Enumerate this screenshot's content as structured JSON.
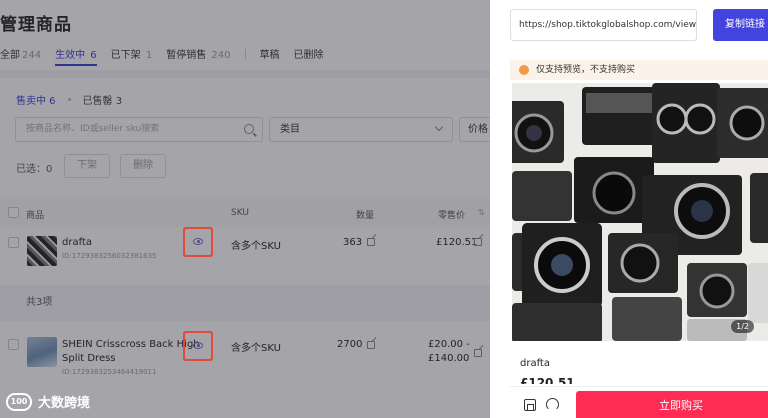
{
  "page": {
    "title": "管理商品",
    "status_tabs": [
      {
        "label": "全部",
        "count": "244"
      },
      {
        "label": "生效中",
        "count": "6"
      },
      {
        "label": "已下架",
        "count": "1"
      },
      {
        "label": "暂停销售",
        "count": "240"
      },
      {
        "label": "草稿",
        "count": ""
      },
      {
        "label": "已删除",
        "count": ""
      }
    ],
    "sub_tabs": [
      {
        "label": "售卖中 6"
      },
      {
        "label": "已售罄 3"
      }
    ],
    "search_placeholder": "按商品名称、ID或seller sku搜索",
    "category_select": "类目",
    "price_select": "价格",
    "selected_label": "已选：0",
    "delist_button": "下架",
    "delete_button": "删除",
    "table_headers": {
      "product": "商品",
      "sku": "SKU",
      "quantity": "数量",
      "retail_price": "零售价"
    },
    "rows": [
      {
        "name": "drafta",
        "id": "ID:1729383256032381635",
        "sku": "含多个SKU",
        "qty": "363",
        "price": "£120.51",
        "price2": ""
      },
      {
        "name": "SHEIN Crisscross Back High Split Dress",
        "name_line1": "SHEIN Crisscross Back High",
        "name_line2": "Split Dress",
        "id": "ID:1729383253464419011",
        "sku": "含多个SKU",
        "qty": "2700",
        "price": "£20.00 -",
        "price2": "£140.00"
      }
    ],
    "total_label": "共3项"
  },
  "panel": {
    "url": "https://shop.tiktokglobalshop.com/view/p",
    "copy_button": "复制链接",
    "hint": "仅支持预览，不支持购买",
    "image_counter": "1/2",
    "product_title": "drafta",
    "price_partial": "£120.51",
    "buy_button": "立即购买"
  },
  "watermark": {
    "text": "大数跨境",
    "logo": "100"
  },
  "colors": {
    "accent": "#3a3ad8",
    "copy_button": "#4343e0",
    "buy_button": "#fe2c55",
    "highlight_box": "#e24a3e",
    "hint_bg": "#fbf3e9",
    "hint_icon": "#f39a4a"
  }
}
